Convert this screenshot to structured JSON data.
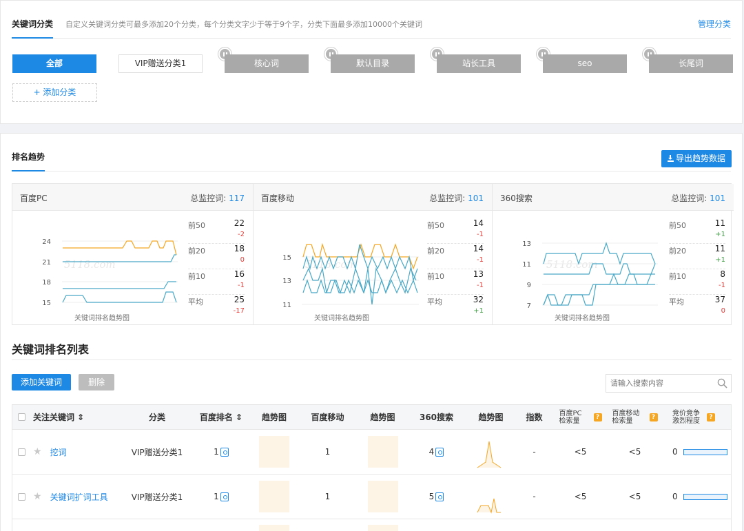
{
  "category_panel": {
    "tab_title": "关键词分类",
    "description": "自定义关键词分类可最多添加20个分类，每个分类文字少于等于9个字，分类下面最多添加10000个关键词",
    "manage_link": "管理分类",
    "categories": [
      "全部",
      "VIP赠送分类1",
      "核心词",
      "默认目录",
      "站长工具",
      "seo",
      "长尾词"
    ],
    "add_category": "+ 添加分类"
  },
  "trend_panel": {
    "tab_title": "排名趋势",
    "export_button": "导出趋势数据",
    "chart_caption": "关键词排名趋势图",
    "watermark": "5118.com",
    "sources": [
      {
        "name": "百度PC",
        "total_label": "总监控词:",
        "total": "117",
        "y_ticks": [
          "24",
          "21",
          "18",
          "15"
        ],
        "stats": [
          {
            "label": "前50",
            "value": "22",
            "delta": "-2"
          },
          {
            "label": "前20",
            "value": "18",
            "delta": "0"
          },
          {
            "label": "前10",
            "value": "16",
            "delta": "-1"
          },
          {
            "label": "平均",
            "value": "25",
            "delta": "-17"
          }
        ]
      },
      {
        "name": "百度移动",
        "total_label": "总监控词:",
        "total": "101",
        "y_ticks": [
          "15",
          "13",
          "11"
        ],
        "stats": [
          {
            "label": "前50",
            "value": "14",
            "delta": "-1"
          },
          {
            "label": "前20",
            "value": "14",
            "delta": "-1"
          },
          {
            "label": "前10",
            "value": "13",
            "delta": "-1"
          },
          {
            "label": "平均",
            "value": "32",
            "delta": "+1"
          }
        ]
      },
      {
        "name": "360搜索",
        "total_label": "总监控词:",
        "total": "101",
        "y_ticks": [
          "13",
          "11",
          "9",
          "7"
        ],
        "stats": [
          {
            "label": "前50",
            "value": "11",
            "delta": "+1"
          },
          {
            "label": "前20",
            "value": "11",
            "delta": "+1"
          },
          {
            "label": "前10",
            "value": "8",
            "delta": "-1"
          },
          {
            "label": "平均",
            "value": "37",
            "delta": "0"
          }
        ]
      }
    ]
  },
  "keyword_list": {
    "title": "关键词排名列表",
    "add_button": "添加关键词",
    "delete_button": "删除",
    "search_placeholder": "请输入搜索内容",
    "columns": {
      "keyword": "关注关键词 ⇕",
      "category": "分类",
      "baidu_rank": "百度排名 ⇕",
      "trend1": "趋势图",
      "baidu_mobile": "百度移动",
      "trend2": "趋势图",
      "so360": "360搜索",
      "trend3": "趋势图",
      "index": "指数",
      "pc_volume": "百度PC 检索量",
      "mobile_volume": "百度移动 检索量",
      "competition": "竞价竞争 激烈程度"
    },
    "help_mark": "?",
    "rows": [
      {
        "keyword": "挖词",
        "category": "VIP赠送分类1",
        "baidu_rank": "1",
        "baidu_mobile": "1",
        "so360": "4",
        "index": "-",
        "pc_volume": "<5",
        "mobile_volume": "<5",
        "competition": "0"
      },
      {
        "keyword": "关键词扩词工具",
        "category": "VIP赠送分类1",
        "baidu_rank": "1",
        "baidu_mobile": "1",
        "so360": "5",
        "index": "-",
        "pc_volume": "<5",
        "mobile_volume": "<5",
        "competition": "0"
      }
    ]
  },
  "colors": {
    "accent": "#1e88e5",
    "orange": "#f5a623",
    "teal": "#4aa8c7"
  }
}
